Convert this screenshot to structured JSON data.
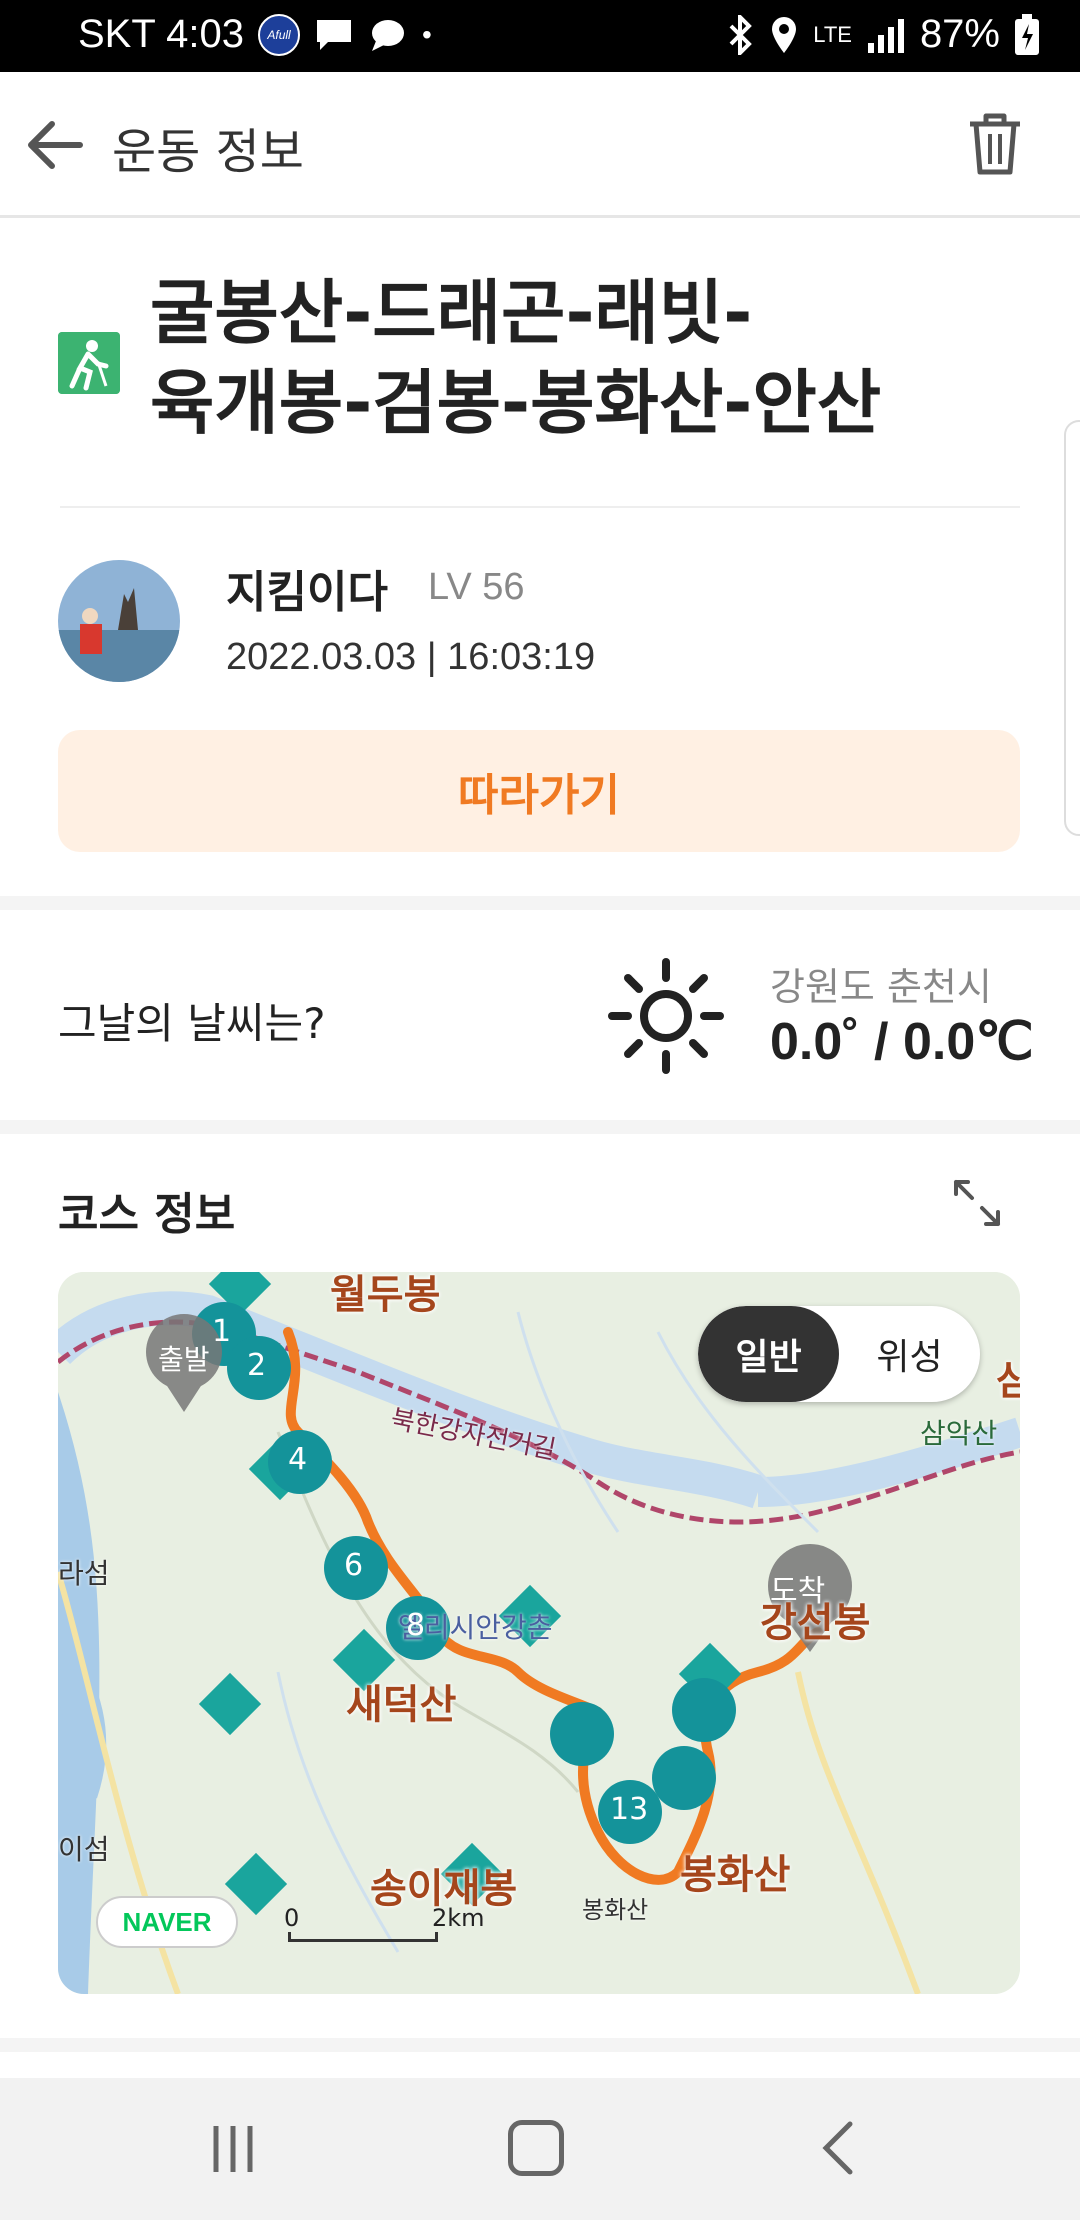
{
  "status_bar": {
    "carrier_time": "SKT 4:03",
    "badge_label": "Afull",
    "dot": "•",
    "network": "LTE",
    "battery": "87%"
  },
  "app_bar": {
    "title": "운동 정보"
  },
  "activity": {
    "title": "굴봉산-드래곤-래빗-육개봉-검봉-봉화산-안산",
    "title_line1": "굴봉산-드래곤-래빗-",
    "title_line2": "육개봉-검봉-봉화산-안산",
    "icon": "hiking-icon"
  },
  "user": {
    "name": "지킴이다",
    "level": "LV 56",
    "datetime": "2022.03.03 | 16:03:19"
  },
  "follow_button": "따라가기",
  "weather": {
    "question": "그날의 날씨는?",
    "location": "강원도 춘천시",
    "temperature": "0.0˚ / 0.0℃",
    "icon": "sun-icon"
  },
  "course": {
    "title": "코스 정보",
    "map_toggle": {
      "normal": "일반",
      "satellite": "위성",
      "selected": "일반"
    },
    "map_labels": {
      "top_peak": "월두봉",
      "bike_road": "북한강자전거길",
      "west_island": "라섬",
      "saedeoksan": "새덕산",
      "elysian": "엘리시안강촌",
      "songijaebong": "송이재봉",
      "bonghwasan": "봉화산",
      "bonghwasan_small": "봉화산",
      "gangseonbong": "강선봉",
      "samaksan": "삼악산",
      "sam_edge": "삼",
      "i_seom": "이섬",
      "arrival": "도착",
      "start": "출발"
    },
    "markers": [
      "1",
      "2",
      "4",
      "6",
      "8",
      "13"
    ],
    "scale": {
      "zero": "0",
      "two": "2km"
    },
    "naver_logo": "NAVER",
    "colors": {
      "route": "#f07a22",
      "marker": "#14939a",
      "peak": "#1aa59d"
    }
  },
  "nav_bar": {
    "recent": "recent-apps",
    "home": "home",
    "back": "back"
  }
}
